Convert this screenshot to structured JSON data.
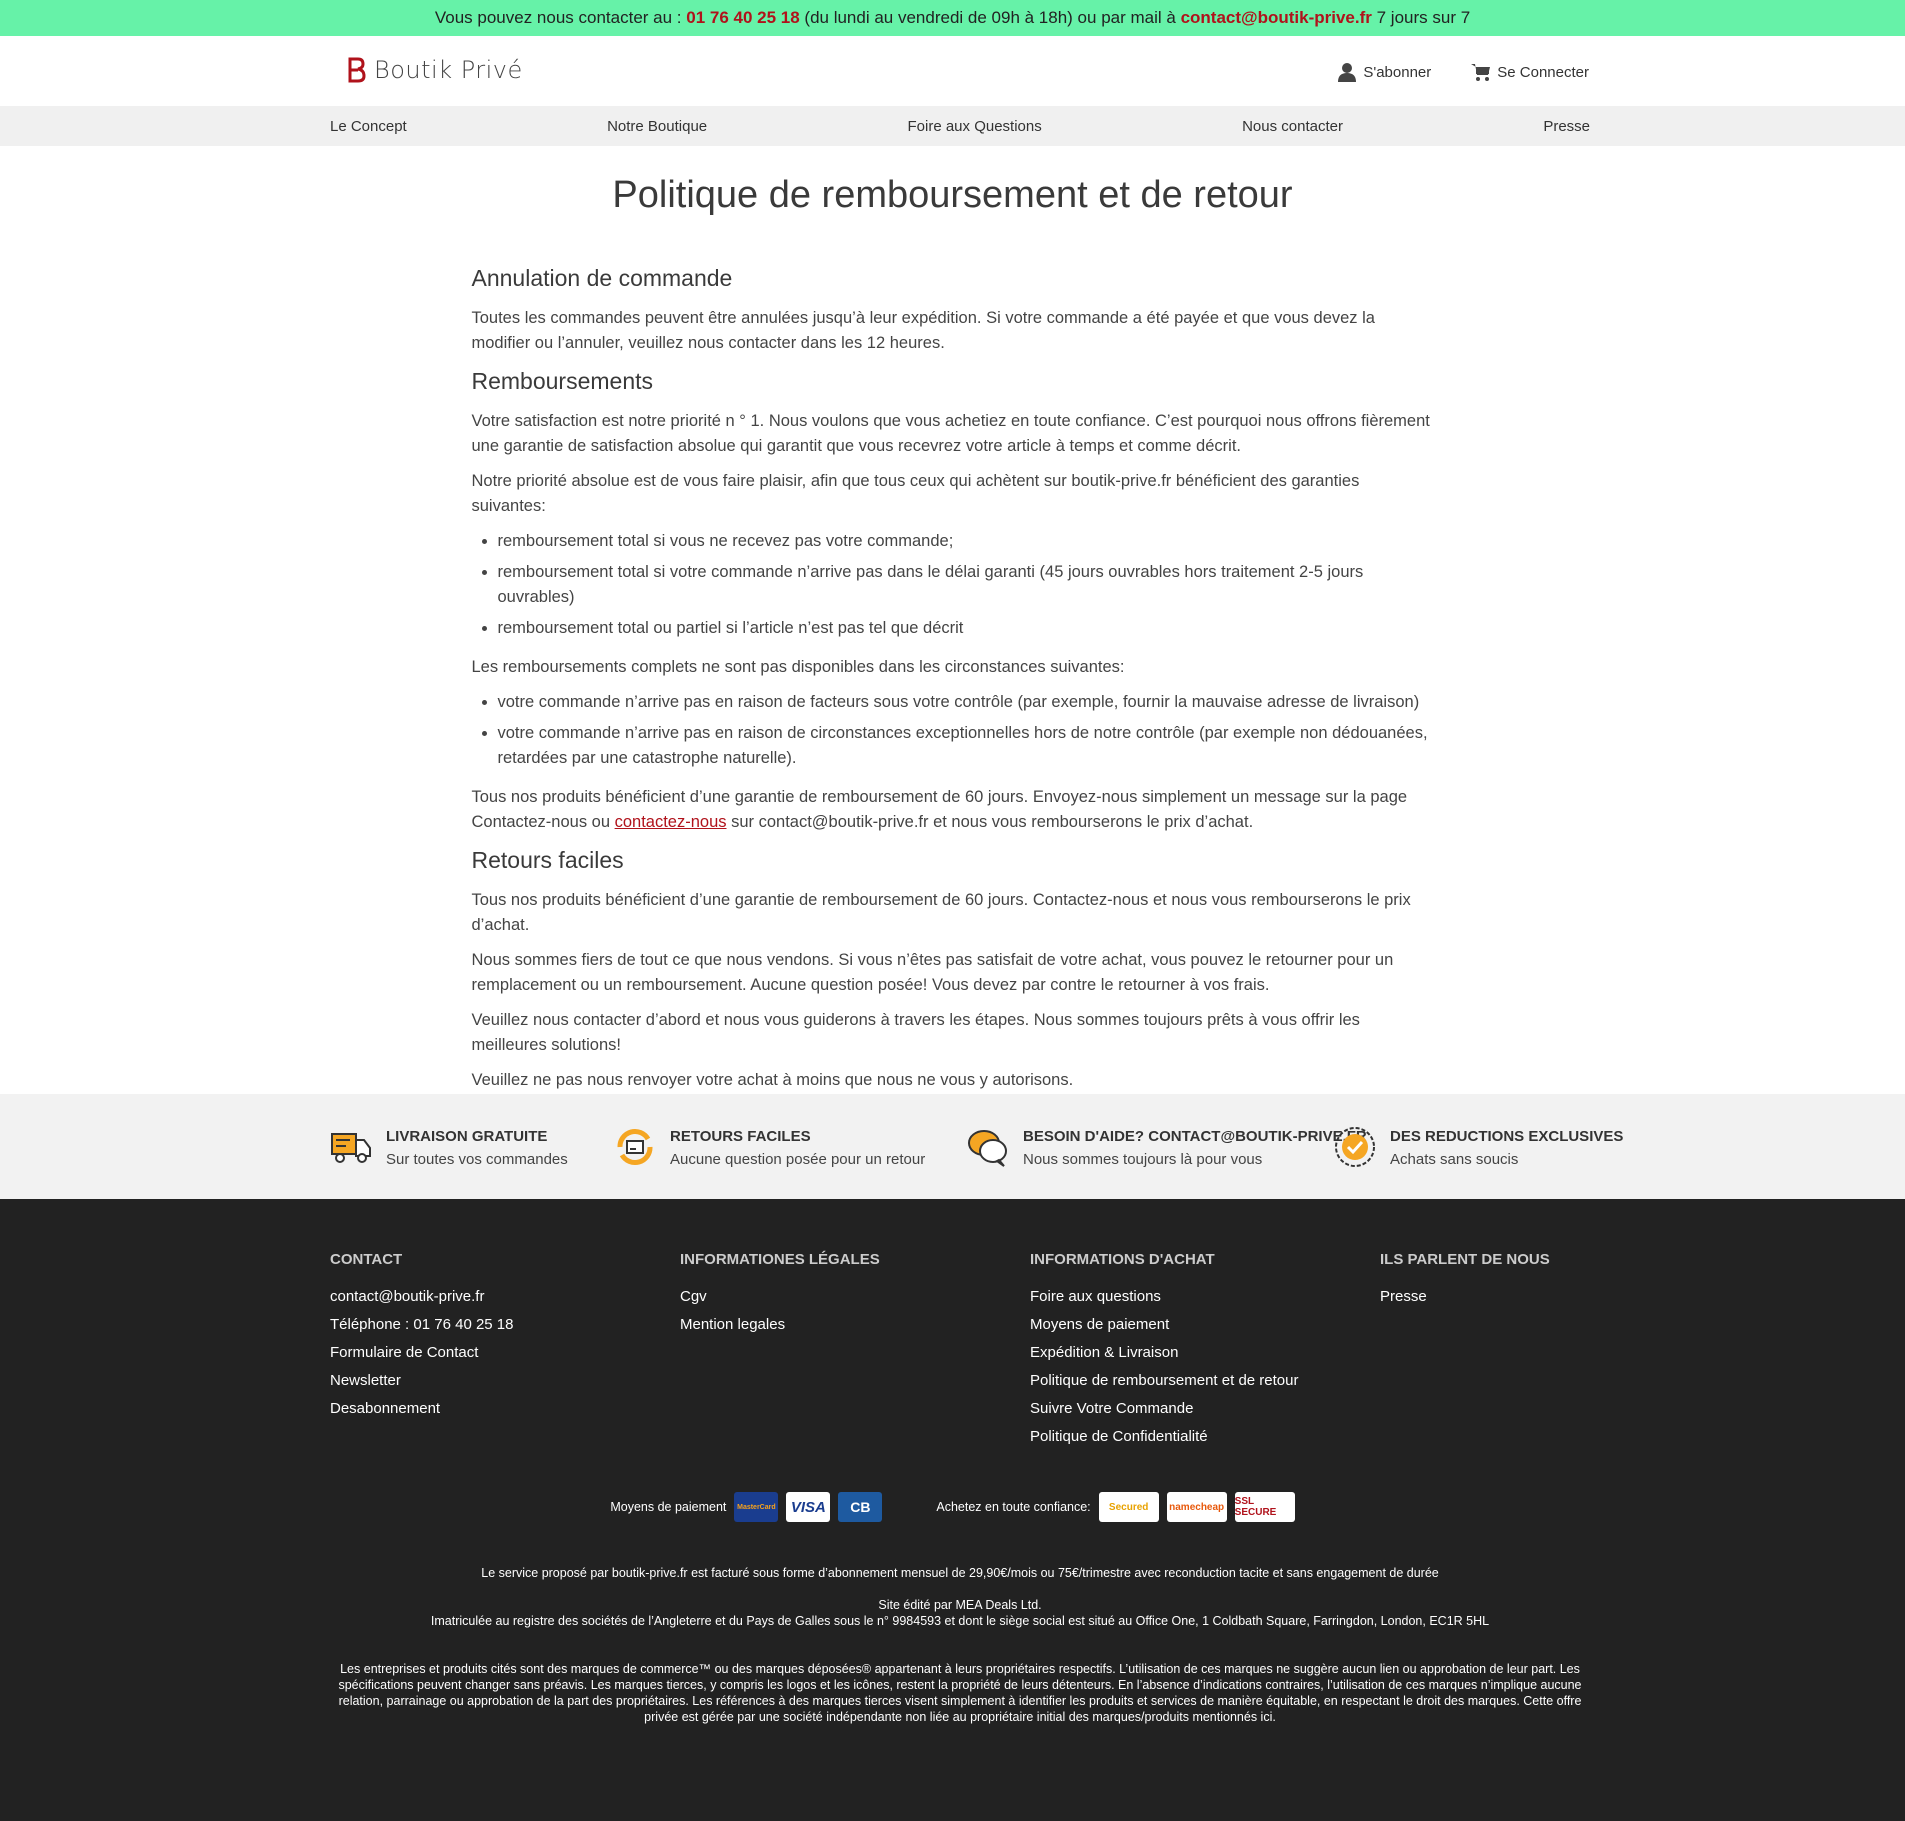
{
  "topbar": {
    "prefix": "Vous pouvez nous contacter au : ",
    "phone": "01 76 40 25 18",
    "middle": " (du lundi au vendredi de 09h à 18h) ou par mail à ",
    "email": "contact@boutik-prive.fr",
    "suffix": " 7 jours sur 7"
  },
  "header": {
    "logo_text": "Boutik Privé",
    "subscribe": "S'abonner",
    "login": "Se Connecter"
  },
  "nav": [
    "Le Concept",
    "Notre Boutique",
    "Foire aux Questions",
    "Nous contacter",
    "Presse"
  ],
  "page": {
    "title": "Politique de remboursement et de retour",
    "s1_title": "Annulation de commande",
    "s1_p1": "Toutes les commandes peuvent être annulées jusqu’à leur expédition. Si votre commande a été payée et que vous devez la modifier ou l’annuler, veuillez nous contacter dans les 12 heures.",
    "s2_title": "Remboursements",
    "s2_p1": "Votre satisfaction est notre priorité n ° 1. Nous voulons que vous achetiez en toute confiance. C’est pourquoi nous offrons fièrement une garantie de satisfaction absolue qui garantit que vous recevrez votre article à temps et comme décrit.",
    "s2_p2": "Notre priorité absolue est de vous faire plaisir, afin que tous ceux qui achètent sur boutik-prive.fr bénéficient des garanties suivantes:",
    "s2_list1": [
      "remboursement total si vous ne recevez pas votre commande;",
      "remboursement total si votre commande n’arrive pas dans le délai garanti (45 jours ouvrables hors traitement 2-5 jours ouvrables)",
      "remboursement total ou partiel si l’article n’est pas tel que décrit"
    ],
    "s2_p3": "Les remboursements complets ne sont pas disponibles dans les circonstances suivantes:",
    "s2_list2": [
      "votre commande n’arrive pas en raison de facteurs sous votre contrôle (par exemple, fournir la mauvaise adresse de livraison)",
      "votre commande n’arrive pas en raison de circonstances exceptionnelles hors de notre contrôle (par exemple non dédouanées, retardées par une catastrophe naturelle)."
    ],
    "s2_p4_a": "Tous nos produits bénéficient d’une garantie de remboursement de 60 jours. Envoyez-nous simplement un message sur la page Contactez-nous ou ",
    "s2_p4_link": "contactez-nous",
    "s2_p4_b": " sur contact@boutik-prive.fr et nous vous rembourserons le prix d’achat.",
    "s3_title": "Retours faciles",
    "s3_p1": "Tous nos produits bénéficient d’une garantie de remboursement de 60 jours. Contactez-nous et nous vous rembourserons le prix d’achat.",
    "s3_p2": "Nous sommes fiers de tout ce que nous vendons. Si vous n’êtes pas satisfait de votre achat, vous pouvez le retourner pour un remplacement ou un remboursement. Aucune question posée! Vous devez par contre le retourner à vos frais.",
    "s3_p3": "Veuillez nous contacter d’abord et nous vous guiderons à travers les étapes. Nous sommes toujours prêts à vous offrir les meilleures solutions!",
    "s3_p4": "Veuillez ne pas nous renvoyer votre achat à moins que nous ne vous y autorisons."
  },
  "features": [
    {
      "title": "LIVRAISON GRATUITE",
      "sub": "Sur toutes vos commandes",
      "icon": "truck-icon"
    },
    {
      "title": "RETOURS FACILES",
      "sub": "Aucune question posée pour un retour",
      "icon": "return-icon"
    },
    {
      "title": "BESOIN D'AIDE? contact@boutik-prive.fr",
      "sub": "Nous sommes toujours là pour vous",
      "icon": "chat-icon"
    },
    {
      "title": "DES REDUCTIONS EXCLUSIVES",
      "sub": "Achats sans soucis",
      "icon": "check-badge-icon"
    }
  ],
  "footer": {
    "contact": {
      "title": "CONTACT",
      "items": [
        "contact@boutik-prive.fr",
        "Téléphone : 01 76 40 25 18",
        "Formulaire de Contact",
        "Newsletter",
        "Desabonnement"
      ]
    },
    "legal": {
      "title": "INFORMATIONES LÉGALES",
      "items": [
        "Cgv",
        "Mention legales"
      ]
    },
    "achat": {
      "title": "INFORMATIONS D'ACHAT",
      "items": [
        "Foire aux questions",
        "Moyens de paiement",
        "Expédition & Livraison",
        "Politique de remboursement et de retour",
        "Suivre Votre Commande",
        "Politique de Confidentialité"
      ]
    },
    "presse": {
      "title": "ILS PARLENT DE NOUS",
      "items": [
        "Presse"
      ]
    },
    "payment_label": "Moyens de paiement",
    "payment_cards": [
      "MasterCard",
      "VISA",
      "CB"
    ],
    "trust_label": "Achetez en toute confiance:",
    "trust_badges": [
      "Secured",
      "namecheap",
      "SSL SECURE"
    ],
    "billing": "Le service proposé par boutik-prive.fr est facturé sous forme d’abonnement mensuel de 29,90€/mois ou 75€/trimestre avec reconduction tacite et sans engagement de durée",
    "edited": "Site édité par MEA Deals Ltd.",
    "registered": "Imatriculée au registre des sociétés de l’Angleterre et du Pays de Galles sous le n° 9984593 et dont le siège social est situé au Office One, 1 Coldbath Square, Farringdon, London, EC1R 5HL",
    "disclaimer": "Les entreprises et produits cités sont des marques de commerce™ ou des marques déposées® appartenant à leurs propriétaires respectifs. L’utilisation de ces marques ne suggère aucun lien ou approbation de leur part. Les spécifications peuvent changer sans préavis. Les marques tierces, y compris les logos et les icônes, restent la propriété de leurs détenteurs. En l’absence d’indications contraires, l’utilisation de ces marques n’implique aucune relation, parrainage ou approbation de la part des propriétaires. Les références à des marques tierces visent simplement à identifier les produits et services de manière équitable, en respectant le droit des marques. Cette offre privée est gérée par une société indépendante non liée au propriétaire initial des marques/produits mentionnés ici."
  },
  "colors": {
    "accent": "#b0121b",
    "topbar": "#66f2a8",
    "footer": "#222222",
    "icon_orange": "#f5a623"
  }
}
